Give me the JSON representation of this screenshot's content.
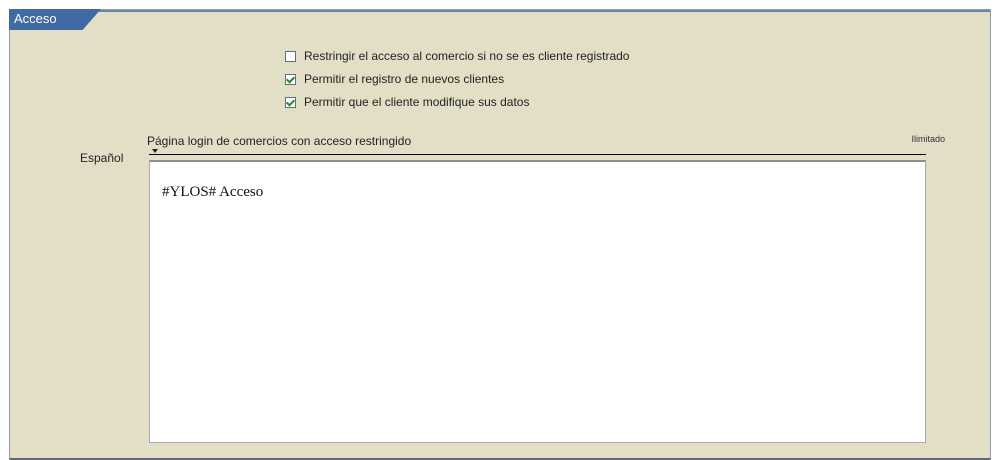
{
  "tab": {
    "label": "Acceso"
  },
  "options": [
    {
      "label": "Restringir el acceso al comercio si no se es cliente registrado",
      "checked": false
    },
    {
      "label": "Permitir el registro de nuevos clientes",
      "checked": true
    },
    {
      "label": "Permitir que el cliente modifique sus datos",
      "checked": true
    }
  ],
  "login_page": {
    "field_label": "Página login de comercios con acceso restringido",
    "limit_label": "Ilimitado",
    "language_label": "Español",
    "content": "#YLOS# Acceso"
  }
}
